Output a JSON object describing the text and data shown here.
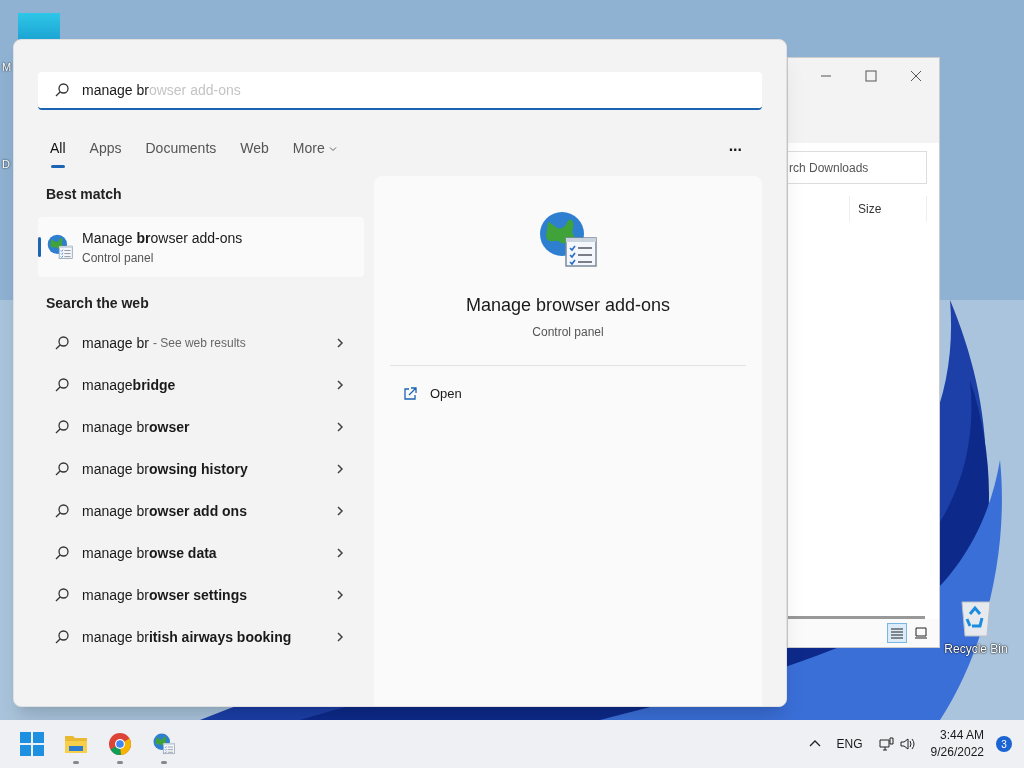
{
  "desktop": {
    "icon_labels": [
      "M",
      "D"
    ],
    "recycle_bin": "Recycle Bin"
  },
  "explorer": {
    "search": {
      "placeholder": "rch Downloads"
    },
    "columns": [
      "Size"
    ],
    "views": [
      {
        "kind": "details",
        "selected": true
      },
      {
        "kind": "tiles",
        "selected": false
      }
    ]
  },
  "search": {
    "query": "manage br",
    "completion": "owser add-ons",
    "tabs": [
      {
        "label": "All",
        "selected": true
      },
      {
        "label": "Apps",
        "selected": false
      },
      {
        "label": "Documents",
        "selected": false
      },
      {
        "label": "Web",
        "selected": false
      },
      {
        "label": "More",
        "selected": false,
        "dropdown": true
      }
    ],
    "more_options": "...",
    "best_match": {
      "heading": "Best match",
      "title": "Manage **br**owser add-ons",
      "subtitle": "Control panel",
      "selected": true
    },
    "web": {
      "heading": "Search the web",
      "items": [
        {
          "text": "manage br",
          "hint": "- See web results"
        },
        {
          "text": "manage**bridge**"
        },
        {
          "text": "manage br**owser**"
        },
        {
          "text": "manage br**owsing history**"
        },
        {
          "text": "manage br**owser add ons**"
        },
        {
          "text": "manage br**owse data**"
        },
        {
          "text": "manage br**owser settings**"
        },
        {
          "text": "manage br**itish airways booking**"
        }
      ]
    },
    "preview": {
      "title": "Manage browser add-ons",
      "subtitle": "Control panel",
      "actions": [
        {
          "label": "Open"
        }
      ]
    }
  },
  "taskbar": {
    "apps": [
      {
        "kind": "start"
      },
      {
        "kind": "folder",
        "running": true
      },
      {
        "kind": "chrome",
        "running": true
      },
      {
        "kind": "addons",
        "running": true
      }
    ],
    "language": "ENG",
    "time": "3:44 AM",
    "date": "9/26/2022",
    "notifications": "3"
  }
}
